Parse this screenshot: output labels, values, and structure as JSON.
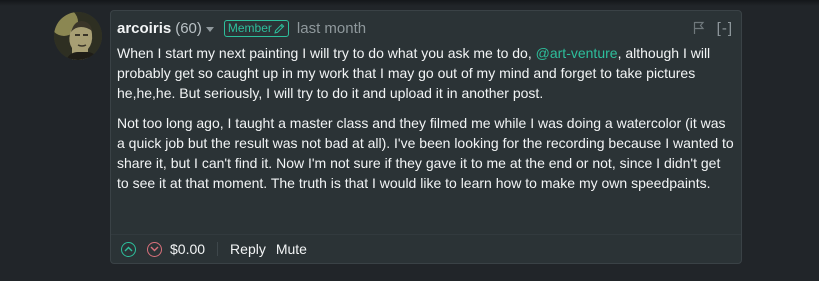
{
  "comment": {
    "author": "arcoiris",
    "reputation": "(60)",
    "badge": "Member",
    "timestamp": "last month",
    "collapse_label": "[-]",
    "body": {
      "p1_before": "When I start my next painting I will try to do what you ask me to do, ",
      "mention": "@art-venture",
      "p1_after": ", although I will probably get so caught up in my work that I may go out of my mind and forget to take pictures he,he,he. But seriously, I will try to do it and upload it in another post.",
      "p2": "Not too long ago, I taught a master class and they filmed me while I was doing a watercolor (it was a quick job but the result was not bad at all). I've been looking for the recording because I wanted to share it, but I can't find it. Now I'm not sure if they gave it to me at the end or not, since I didn't get to see it at that moment. The truth is that I would like to learn how to make my own speedpaints."
    },
    "footer": {
      "payout": "$0.00",
      "reply_label": "Reply",
      "mute_label": "Mute"
    }
  },
  "icons": {
    "badge": "pencil-icon",
    "flag": "flag-icon",
    "upvote": "chevron-up-icon",
    "downvote": "chevron-down-icon",
    "author_menu": "caret-down-icon"
  },
  "colors": {
    "background": "#212529",
    "card": "#2b3336",
    "accent": "#2dbf9c",
    "downvote": "#d9707b",
    "muted": "#8f989c"
  }
}
